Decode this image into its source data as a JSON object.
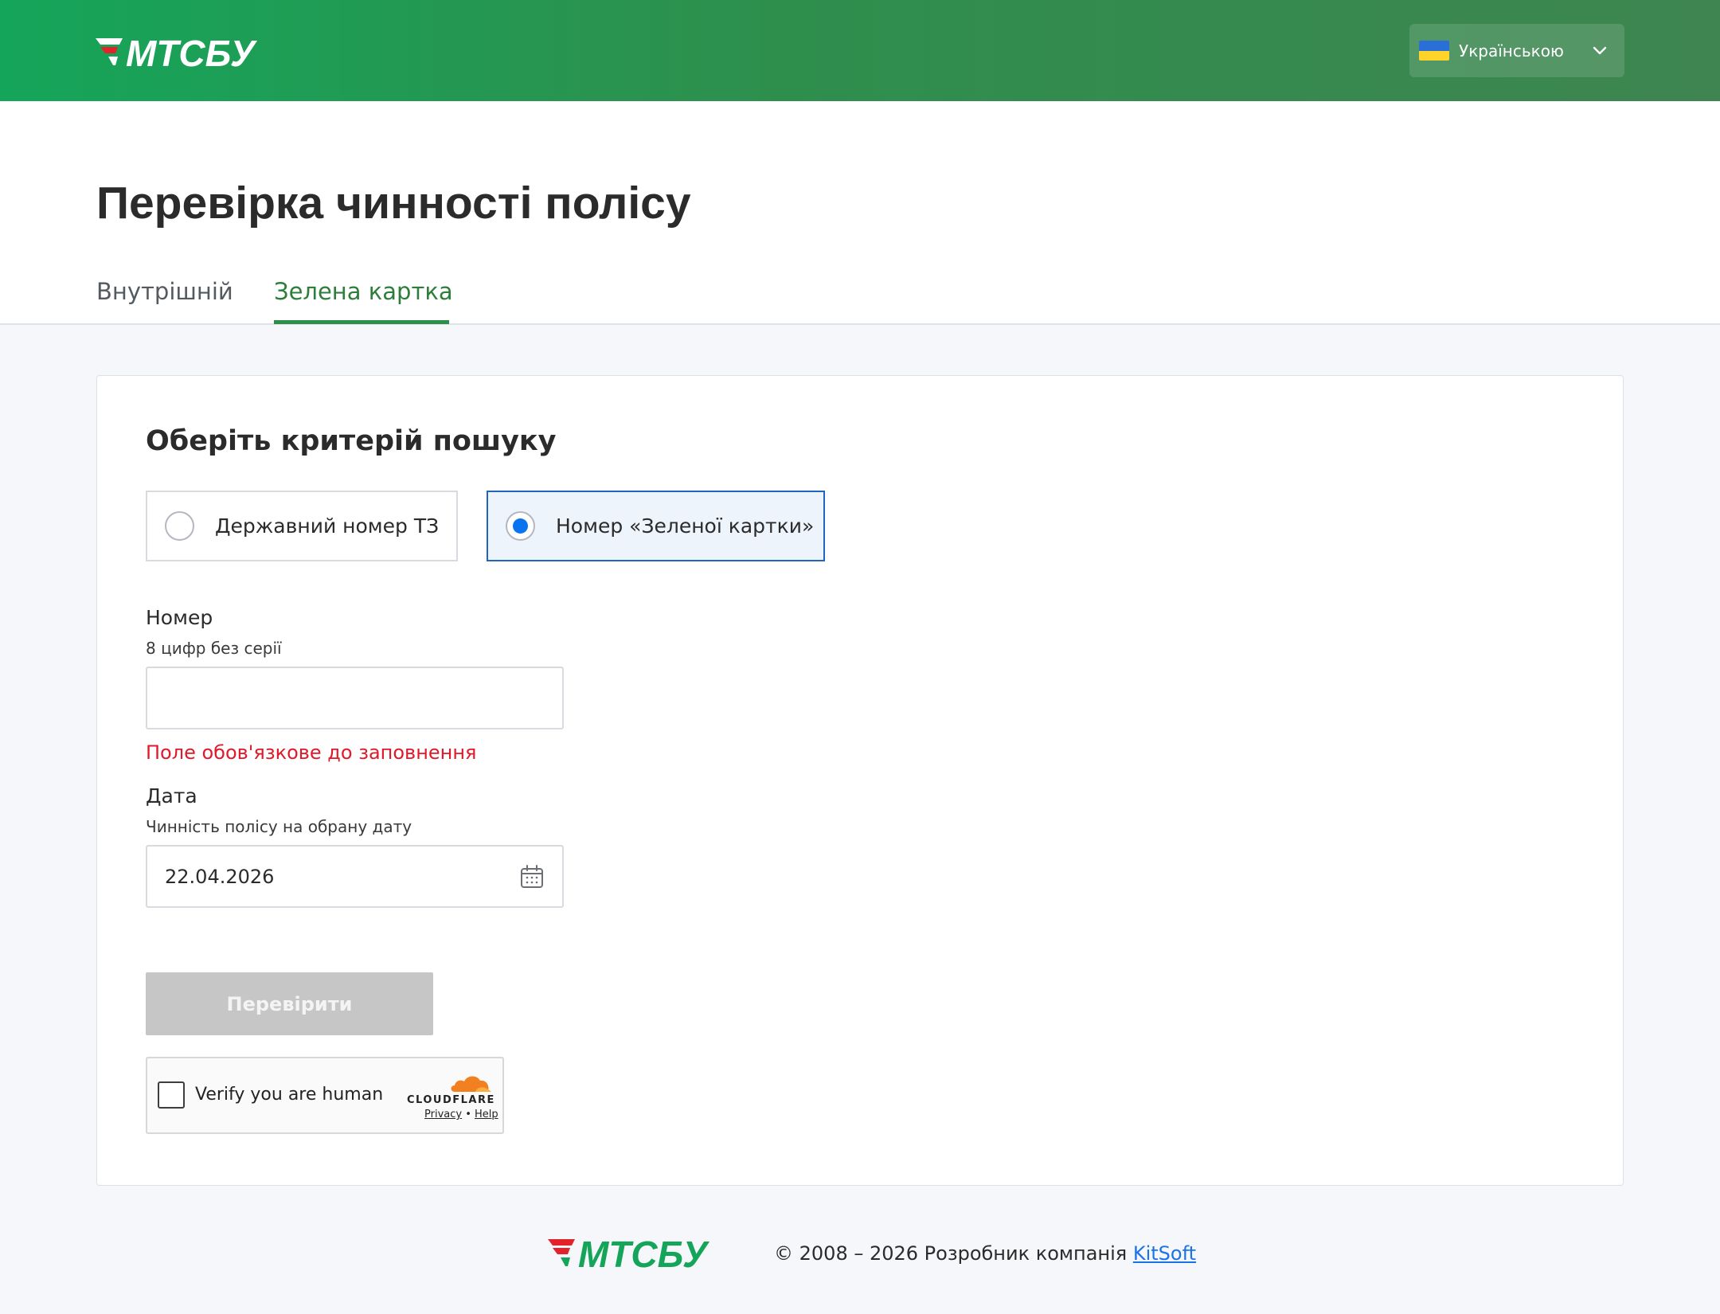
{
  "header": {
    "logo_text": "МТСБУ",
    "language": {
      "label": "Українською",
      "flag": "ukraine-flag",
      "flag_colors": [
        "#2a6fd6",
        "#ffd42a"
      ]
    }
  },
  "page": {
    "title": "Перевірка чинності полісу",
    "tabs": [
      {
        "label": "Внутрішній",
        "active": false
      },
      {
        "label": "Зелена картка",
        "active": true
      }
    ]
  },
  "form": {
    "title": "Оберіть критерій пошуку",
    "criteria": [
      {
        "label": "Державний номер ТЗ",
        "selected": false
      },
      {
        "label": "Номер «Зеленої картки»",
        "selected": true
      }
    ],
    "number": {
      "label": "Номер",
      "hint": "8 цифр без серії",
      "value": "",
      "placeholder": "",
      "error": "Поле обов'язкове до заповнення"
    },
    "date": {
      "label": "Дата",
      "hint": "Чинність полісу на обрану дату",
      "value": "22.04.2026"
    },
    "submit_label": "Перевірити",
    "captcha": {
      "label": "Verify you are human",
      "brand": "CLOUDFLARE",
      "privacy": "Privacy",
      "separator": "•",
      "help": "Help"
    }
  },
  "footer": {
    "logo_text": "МТСБУ",
    "copyright": "© 2008 – 2026 Розробник компанія ",
    "company_link": "KitSoft"
  },
  "colors": {
    "brand_green": "#15a55a",
    "brand_red": "#e3232a",
    "active_tab": "#2e7d3a",
    "selected_border": "#1f66c1",
    "radio_dot": "#0a74f0",
    "error": "#e0192b",
    "link": "#1a73e8"
  }
}
